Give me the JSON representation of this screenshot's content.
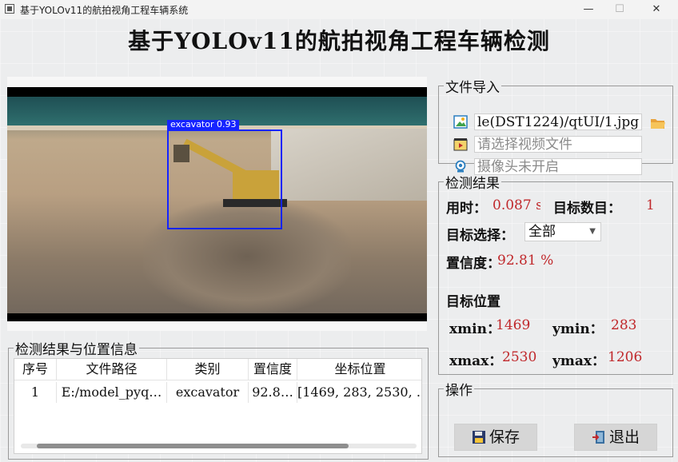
{
  "window": {
    "title": "基于YOLOv11的航拍视角工程车辆系统",
    "controls": [
      "—",
      "☐",
      "✕"
    ]
  },
  "main_title": "基于YOLOv11的航拍视角工程车辆检测",
  "detection_overlay": {
    "label": "excavator 0.93",
    "color": "#1524ff"
  },
  "file_import": {
    "legend": "文件导入",
    "image_path": "le(DST1224)/qtUI/1.jpg",
    "video_placeholder": "请选择视频文件",
    "camera_status": "摄像头未开启",
    "icons": [
      "image-icon",
      "video-icon",
      "camera-icon",
      "folder-open-icon"
    ]
  },
  "results": {
    "legend": "检测结果",
    "time_label": "用时：",
    "time_value": "0.087 s",
    "count_label": "目标数目：",
    "count_value": "1",
    "select_label": "目标选择：",
    "select_value": "全部",
    "conf_label": "置信度：",
    "conf_value": "92.81 %",
    "pos_title": "目标位置",
    "xmin_label": "xmin：",
    "xmin_value": "1469",
    "ymin_label": "ymin：",
    "ymin_value": "283",
    "xmax_label": "xmax：",
    "xmax_value": "2530",
    "ymax_label": "ymax：",
    "ymax_value": "1206",
    "value_color": "#c0282b"
  },
  "table": {
    "legend": "检测结果与位置信息",
    "headers": [
      "序号",
      "文件路径",
      "类别",
      "置信度",
      "坐标位置"
    ],
    "rows": [
      [
        "1",
        "E:/model_pyq…",
        "excavator",
        "92.8…",
        "[1469, 283, 2530, …"
      ]
    ]
  },
  "operations": {
    "legend": "操作",
    "save_label": "保存",
    "exit_label": "退出"
  }
}
